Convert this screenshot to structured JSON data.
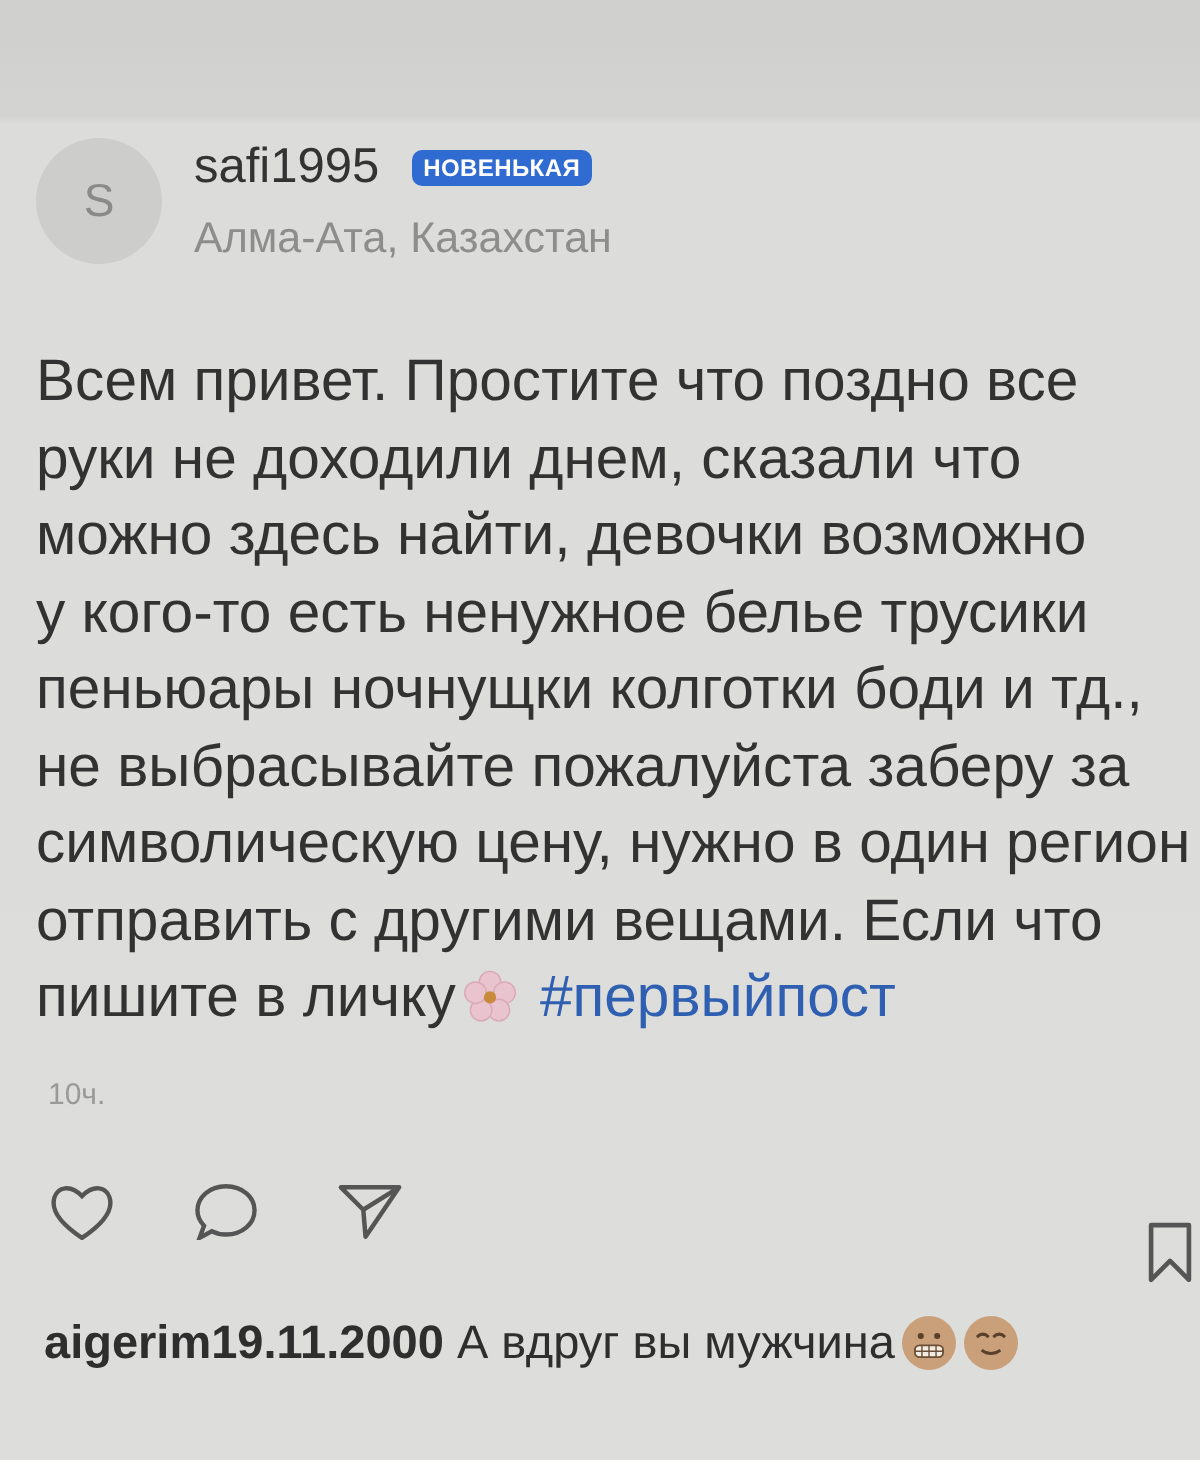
{
  "post": {
    "author": {
      "avatar_letter": "S",
      "username": "safi1995",
      "badge": "НОВЕНЬКАЯ",
      "location": "Алма-Ата, Казахстан"
    },
    "text": "Всем привет. Простите что поздно все\nруки не доходили днем, сказали что\nможно здесь найти, девочки возможно\nу кого-то есть ненужное белье трусики\nпеньюары ночнущки колготки боди и тд.,\nне выбрасывайте пожалуйста заберу за\nсимволическую цену, нужно в один регион\nотправить с другими вещами. Если что\nпишите в личку",
    "hashtag": "#первыйпост",
    "time": "10ч.",
    "liked": false,
    "saved": false
  },
  "comments": [
    {
      "username": "aigerim19.11.2000",
      "text": "А вдруг вы мужчина"
    }
  ]
}
